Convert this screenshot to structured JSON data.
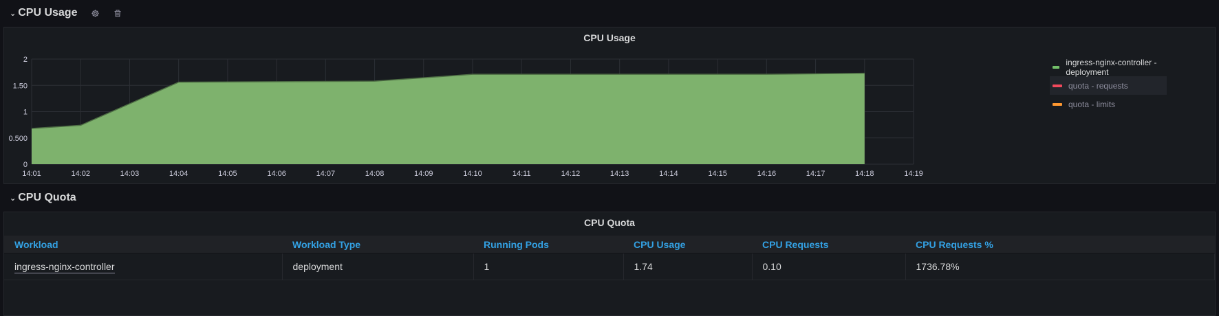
{
  "rows": [
    {
      "title": "CPU Usage",
      "settings_icon": "gear-icon",
      "delete_icon": "trash-icon"
    },
    {
      "title": "CPU Quota"
    }
  ],
  "usage_panel": {
    "title": "CPU Usage",
    "legend": [
      {
        "label": "ingress-nginx-controller - deployment",
        "color": "#73bf69"
      },
      {
        "label": "quota - requests",
        "color": "#f2495c"
      },
      {
        "label": "quota - limits",
        "color": "#ff9830"
      }
    ]
  },
  "quota_panel": {
    "title": "CPU Quota",
    "columns": [
      "Workload",
      "Workload Type",
      "Running Pods",
      "CPU Usage",
      "CPU Requests",
      "CPU Requests %"
    ],
    "rows": [
      [
        "ingress-nginx-controller",
        "deployment",
        "1",
        "1.74",
        "0.10",
        "1736.78%"
      ]
    ]
  },
  "chart_data": {
    "type": "area",
    "title": "CPU Usage",
    "x": [
      "14:01",
      "14:02",
      "14:03",
      "14:04",
      "14:05",
      "14:06",
      "14:07",
      "14:08",
      "14:09",
      "14:10",
      "14:11",
      "14:12",
      "14:13",
      "14:14",
      "14:15",
      "14:16",
      "14:17",
      "14:18",
      "14:19"
    ],
    "ylim": [
      0,
      2
    ],
    "yticks": [
      "0",
      "0.500",
      "1",
      "1.50",
      "2"
    ],
    "grid": true,
    "legend_position": "right",
    "series": [
      {
        "name": "ingress-nginx-controller - deployment",
        "color": "#73bf69",
        "points": [
          [
            "14:01",
            0.68
          ],
          [
            "14:02",
            0.74
          ],
          [
            "14:04",
            1.56
          ],
          [
            "14:08",
            1.58
          ],
          [
            "14:10",
            1.71
          ],
          [
            "14:12",
            1.71
          ],
          [
            "14:16",
            1.71
          ],
          [
            "14:18",
            1.73
          ]
        ]
      },
      {
        "name": "quota - requests",
        "color": "#f2495c",
        "points": []
      },
      {
        "name": "quota - limits",
        "color": "#ff9830",
        "points": []
      }
    ]
  }
}
